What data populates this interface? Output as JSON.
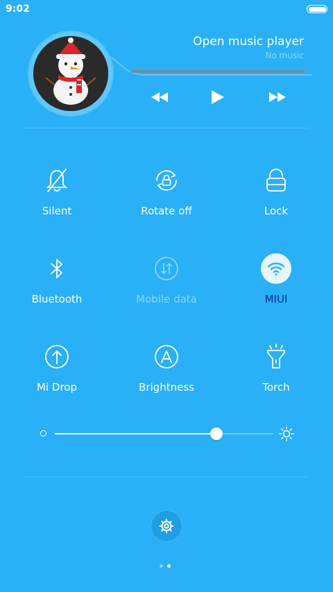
{
  "status": {
    "time": "9:02"
  },
  "music": {
    "title": "Open music player",
    "subtitle": "No music",
    "progress": 0
  },
  "toggles": [
    {
      "label": "Silent",
      "icon": "bell-off-icon",
      "state": "off"
    },
    {
      "label": "Rotate off",
      "icon": "rotation-lock-icon",
      "state": "off"
    },
    {
      "label": "Lock",
      "icon": "lock-icon",
      "state": "off"
    },
    {
      "label": "Bluetooth",
      "icon": "bluetooth-icon",
      "state": "off"
    },
    {
      "label": "Mobile data",
      "icon": "mobile-data-icon",
      "state": "disabled"
    },
    {
      "label": "MIUI",
      "icon": "wifi-icon",
      "state": "on"
    },
    {
      "label": "Mi Drop",
      "icon": "upload-arrow-icon",
      "state": "off"
    },
    {
      "label": "Brightness",
      "icon": "auto-brightness-icon",
      "state": "off"
    },
    {
      "label": "Torch",
      "icon": "flashlight-icon",
      "state": "off"
    }
  ],
  "brightness": {
    "level": 0.74
  },
  "pager": {
    "pages": 2,
    "current": 2
  },
  "colors": {
    "background": "#29b0f6",
    "active_label": "#0b2a9e",
    "disabled_label": "#8fd6fb"
  }
}
